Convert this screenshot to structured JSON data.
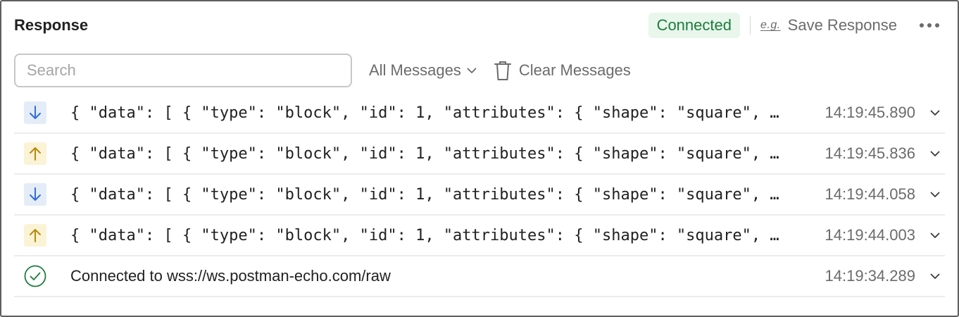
{
  "panel": {
    "title": "Response"
  },
  "header": {
    "status": "Connected",
    "status_color": "#1e7c3c",
    "save_icon_text": "e.g.",
    "save_label": "Save Response"
  },
  "toolbar": {
    "search_placeholder": "Search",
    "search_value": "",
    "filter_label": "All Messages",
    "clear_label": "Clear Messages"
  },
  "messages": [
    {
      "direction": "incoming",
      "icon": "arrow-down-icon",
      "text": "{ \"data\": [ { \"type\": \"block\", \"id\": 1, \"attributes\": { \"shape\": \"square\", \"color\": \"blue\" } } ] }",
      "time": "14:19:45.890"
    },
    {
      "direction": "outgoing",
      "icon": "arrow-up-icon",
      "text": "{ \"data\": [ { \"type\": \"block\", \"id\": 1, \"attributes\": { \"shape\": \"square\", \"color\": \"blue\" } } ] }",
      "time": "14:19:45.836"
    },
    {
      "direction": "incoming",
      "icon": "arrow-down-icon",
      "text": "{ \"data\": [ { \"type\": \"block\", \"id\": 1, \"attributes\": { \"shape\": \"square\", \"color\": \"blue\" } } ] }",
      "time": "14:19:44.058"
    },
    {
      "direction": "outgoing",
      "icon": "arrow-up-icon",
      "text": "{ \"data\": [ { \"type\": \"block\", \"id\": 1, \"attributes\": { \"shape\": \"square\", \"color\": \"blue\" } } ] }",
      "time": "14:19:44.003"
    },
    {
      "direction": "system",
      "icon": "check-circle-icon",
      "text": "Connected to wss://ws.postman-echo.com/raw",
      "time": "14:19:34.289"
    }
  ],
  "colors": {
    "incoming_arrow": "#2f6fd6",
    "outgoing_arrow": "#b88a0a",
    "connected_check": "#1e7c3c"
  }
}
